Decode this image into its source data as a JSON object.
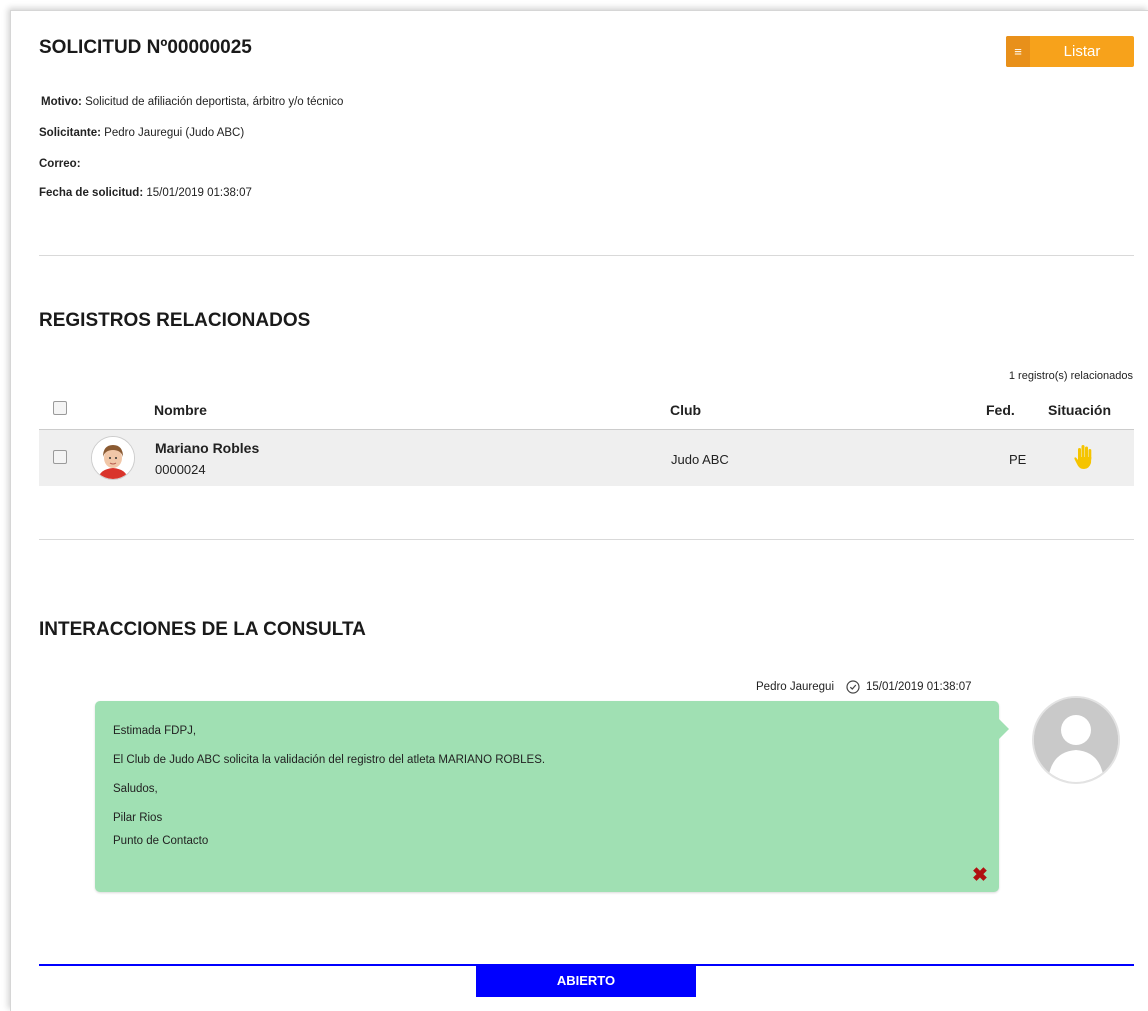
{
  "header": {
    "title": "SOLICITUD Nº00000025",
    "list_button_label": "Listar",
    "list_button_icon": "≡"
  },
  "request": {
    "motivo_label": "Motivo:",
    "motivo_value": " Solicitud de afiliación deportista, árbitro y/o técnico",
    "solicitante_label": "Solicitante:",
    "solicitante_value": " Pedro Jauregui (Judo ABC)",
    "correo_label": "Correo:",
    "correo_value": "",
    "fecha_label": "Fecha de solicitud:",
    "fecha_value": " 15/01/2019 01:38:07"
  },
  "related": {
    "heading": "REGISTROS RELACIONADOS",
    "count_text": "1 registro(s) relacionados",
    "columns": {
      "nombre": "Nombre",
      "club": "Club",
      "fed": "Fed.",
      "situacion": "Situación"
    },
    "rows": [
      {
        "name": "Mariano Robles",
        "id": "0000024",
        "club": "Judo ABC",
        "fed": "PE",
        "status_icon": "hand-icon"
      }
    ]
  },
  "interactions": {
    "heading": "INTERACCIONES DE LA CONSULTA",
    "author": "Pedro Jauregui",
    "timestamp": "15/01/2019 01:38:07",
    "message_lines": [
      "Estimada FDPJ,",
      "El Club de Judo ABC solicita la validación del registro del atleta MARIANO ROBLES.",
      "Saludos,",
      "Pilar Rios",
      "Punto de Contacto"
    ],
    "delete_icon": "✖"
  },
  "status": {
    "label": "ABIERTO"
  },
  "colors": {
    "accent": "#f7a21b",
    "bubble": "#a0e0b3",
    "status": "#0000ff",
    "delete": "#b01010"
  }
}
